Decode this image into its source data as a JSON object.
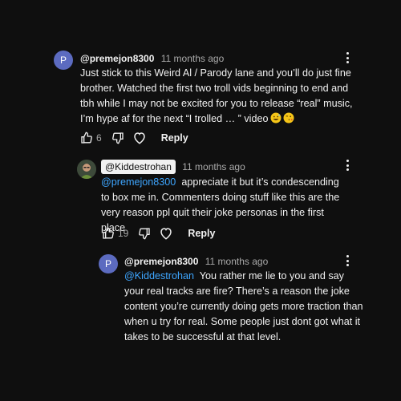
{
  "comments": [
    {
      "avatar_letter": "P",
      "author": "@premejon8300",
      "time": "11 months ago",
      "body": "Just stick to this Weird Al / Parody lane and you’ll do just fine brother. Watched the first two troll vids beginning to end and tbh while I may not be excited for you to release “real” music, I’m hype af for the next “I trolled … ” video",
      "likes": "6",
      "reply_label": "Reply"
    },
    {
      "author": "@Kiddestrohan",
      "time": "11 months ago",
      "mention": "@premejon8300",
      "body": "appreciate it but it’s condescending to box me in. Commenters doing stuff like this are the very reason ppl quit their joke personas in the first place",
      "likes": "19",
      "reply_label": "Reply"
    },
    {
      "avatar_letter": "P",
      "author": "@premejon8300",
      "time": "11 months ago",
      "mention": "@Kiddestrohan",
      "body": "You rather me lie to you and say your real tracks are fire? There’s a reason the joke content you’re currently doing gets more traction than when u try for real. Some people just dont got what it takes to be successful at that level."
    }
  ],
  "colors": {
    "background": "#0f0f0f",
    "text": "#f1f1f1",
    "secondary": "#aaaaaa",
    "mention": "#3ea6ff",
    "avatar_p": "#5c6bc0"
  }
}
